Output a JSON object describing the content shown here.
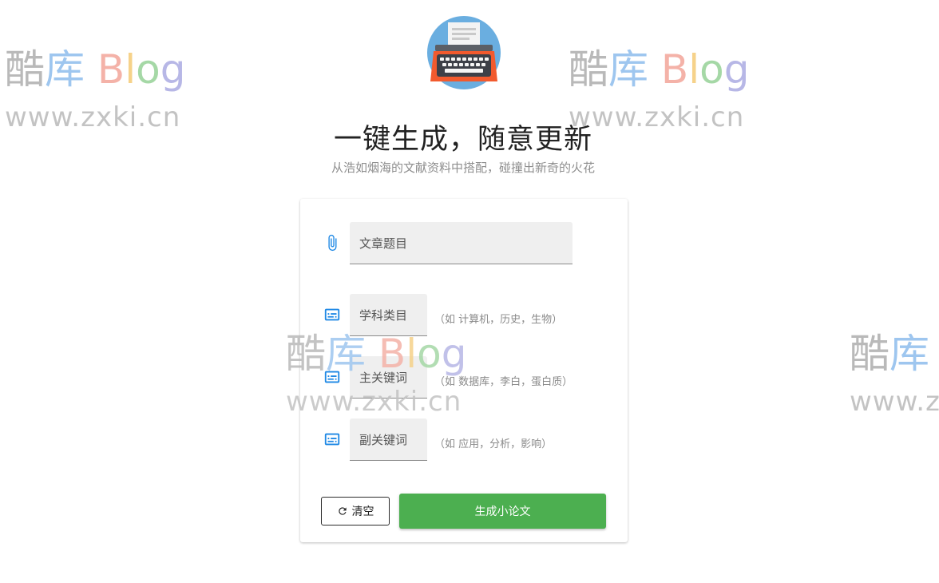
{
  "watermark": {
    "brand_cn1": "酷",
    "brand_cn2": "库",
    "brand_b": "B",
    "brand_l": "l",
    "brand_o": "o",
    "brand_g": "g",
    "url": "www.zxki.cn",
    "url_cut": "www.z"
  },
  "header": {
    "title": "一键生成，随意更新",
    "subtitle": "从浩如烟海的文献资料中搭配，碰撞出新奇的火花"
  },
  "form": {
    "article_title": {
      "placeholder": "文章题目",
      "icon": "paperclip-icon"
    },
    "subject": {
      "placeholder": "学科类目",
      "hint": "（如 计算机，历史，生物）",
      "icon": "subtitles-icon"
    },
    "main_keyword": {
      "placeholder": "主关键词",
      "hint": "（如 数据库，李白，蛋白质）",
      "icon": "subtitles-icon"
    },
    "sub_keyword": {
      "placeholder": "副关键词",
      "hint": "（如 应用，分析，影响）",
      "icon": "subtitles-icon"
    }
  },
  "actions": {
    "clear_label": "清空",
    "generate_label": "生成小论文"
  },
  "colors": {
    "accent_blue": "#1e88e5",
    "generate_green": "#4caf50"
  }
}
